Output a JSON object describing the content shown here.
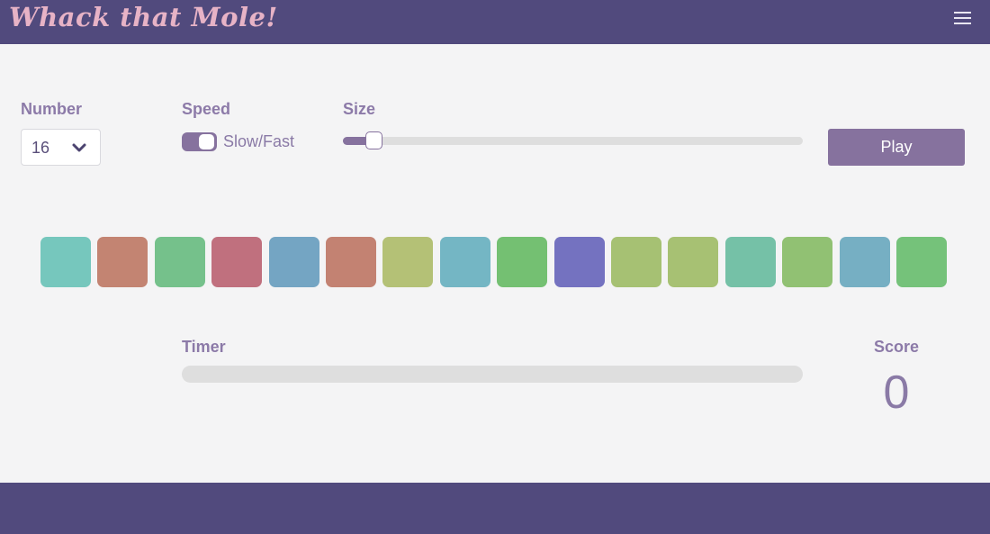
{
  "header": {
    "title": "Whack that Mole!",
    "menu_icon": "hamburger-menu-icon",
    "background_color": "#514a7d",
    "title_color": "#e7b3c6"
  },
  "controls": {
    "number": {
      "label": "Number",
      "value": "16",
      "icon": "chevron-down-icon"
    },
    "speed": {
      "label": "Speed",
      "toggle_text": "Slow/Fast",
      "fast": true
    },
    "size": {
      "label": "Size",
      "value_fraction": 0.05
    },
    "play_label": "Play"
  },
  "board": {
    "moles": [
      {
        "color": "#76c7bd"
      },
      {
        "color": "#c38472"
      },
      {
        "color": "#75c18b"
      },
      {
        "color": "#c0707e"
      },
      {
        "color": "#74a5c3"
      },
      {
        "color": "#c38272"
      },
      {
        "color": "#b4c176"
      },
      {
        "color": "#74b6c4"
      },
      {
        "color": "#74c072"
      },
      {
        "color": "#7472c0"
      },
      {
        "color": "#a6c173"
      },
      {
        "color": "#a7c173"
      },
      {
        "color": "#75c1a7"
      },
      {
        "color": "#91c173"
      },
      {
        "color": "#76afc3"
      },
      {
        "color": "#75c27a"
      }
    ]
  },
  "status": {
    "timer_label": "Timer",
    "timer_fraction": 0,
    "score_label": "Score",
    "score_value": "0"
  },
  "colors": {
    "accent": "#86729e",
    "text": "#8a7aa6",
    "background": "#f4f4f5",
    "track": "#dedede"
  }
}
